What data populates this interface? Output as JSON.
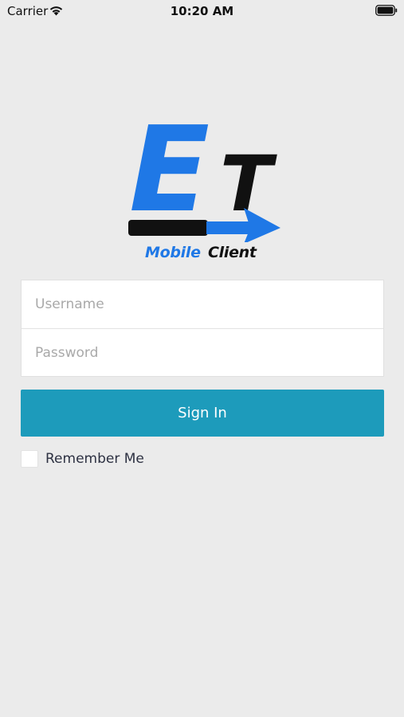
{
  "status_bar": {
    "carrier": "Carrier",
    "time": "10:20 AM",
    "wifi_icon": "wifi-icon",
    "battery_icon": "battery-icon"
  },
  "logo": {
    "letter_e": "E",
    "letter_t": "T",
    "caption_blue": "Mobile",
    "caption_black": "Client",
    "colors": {
      "blue": "#1f78e6",
      "black": "#111111"
    }
  },
  "login_form": {
    "username": {
      "value": "",
      "placeholder": "Username"
    },
    "password": {
      "value": "",
      "placeholder": "Password"
    },
    "sign_in_label": "Sign In",
    "remember_me_label": "Remember Me",
    "remember_me_checked": false
  },
  "colors": {
    "background": "#ebebeb",
    "accent": "#1d9bbb"
  }
}
